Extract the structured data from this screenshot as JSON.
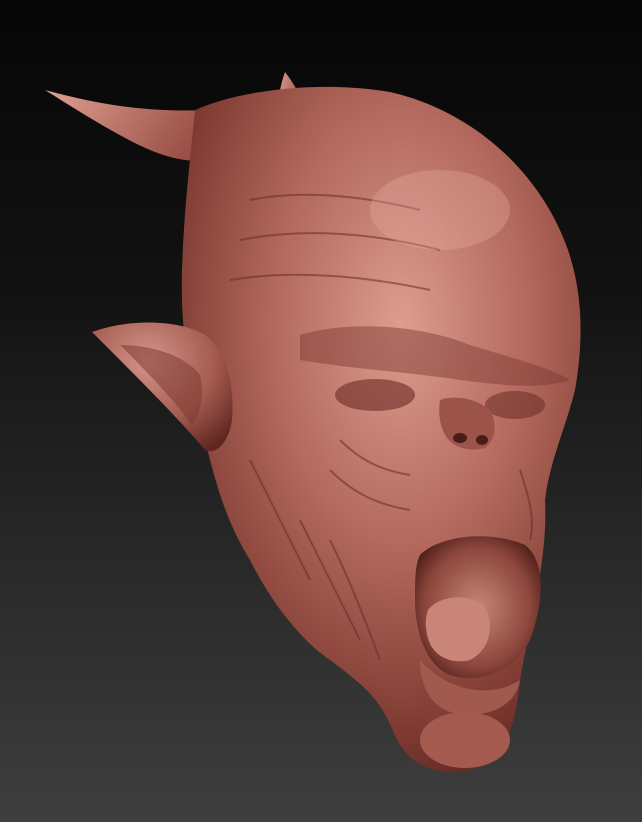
{
  "canvas": {
    "background_top": "#060606",
    "background_bottom": "#3e3e3e"
  },
  "sculpt": {
    "subject": "creature-head",
    "material_color": "#b46a5e",
    "shadow_color": "#5a2620",
    "highlight_color": "#e0a193"
  }
}
